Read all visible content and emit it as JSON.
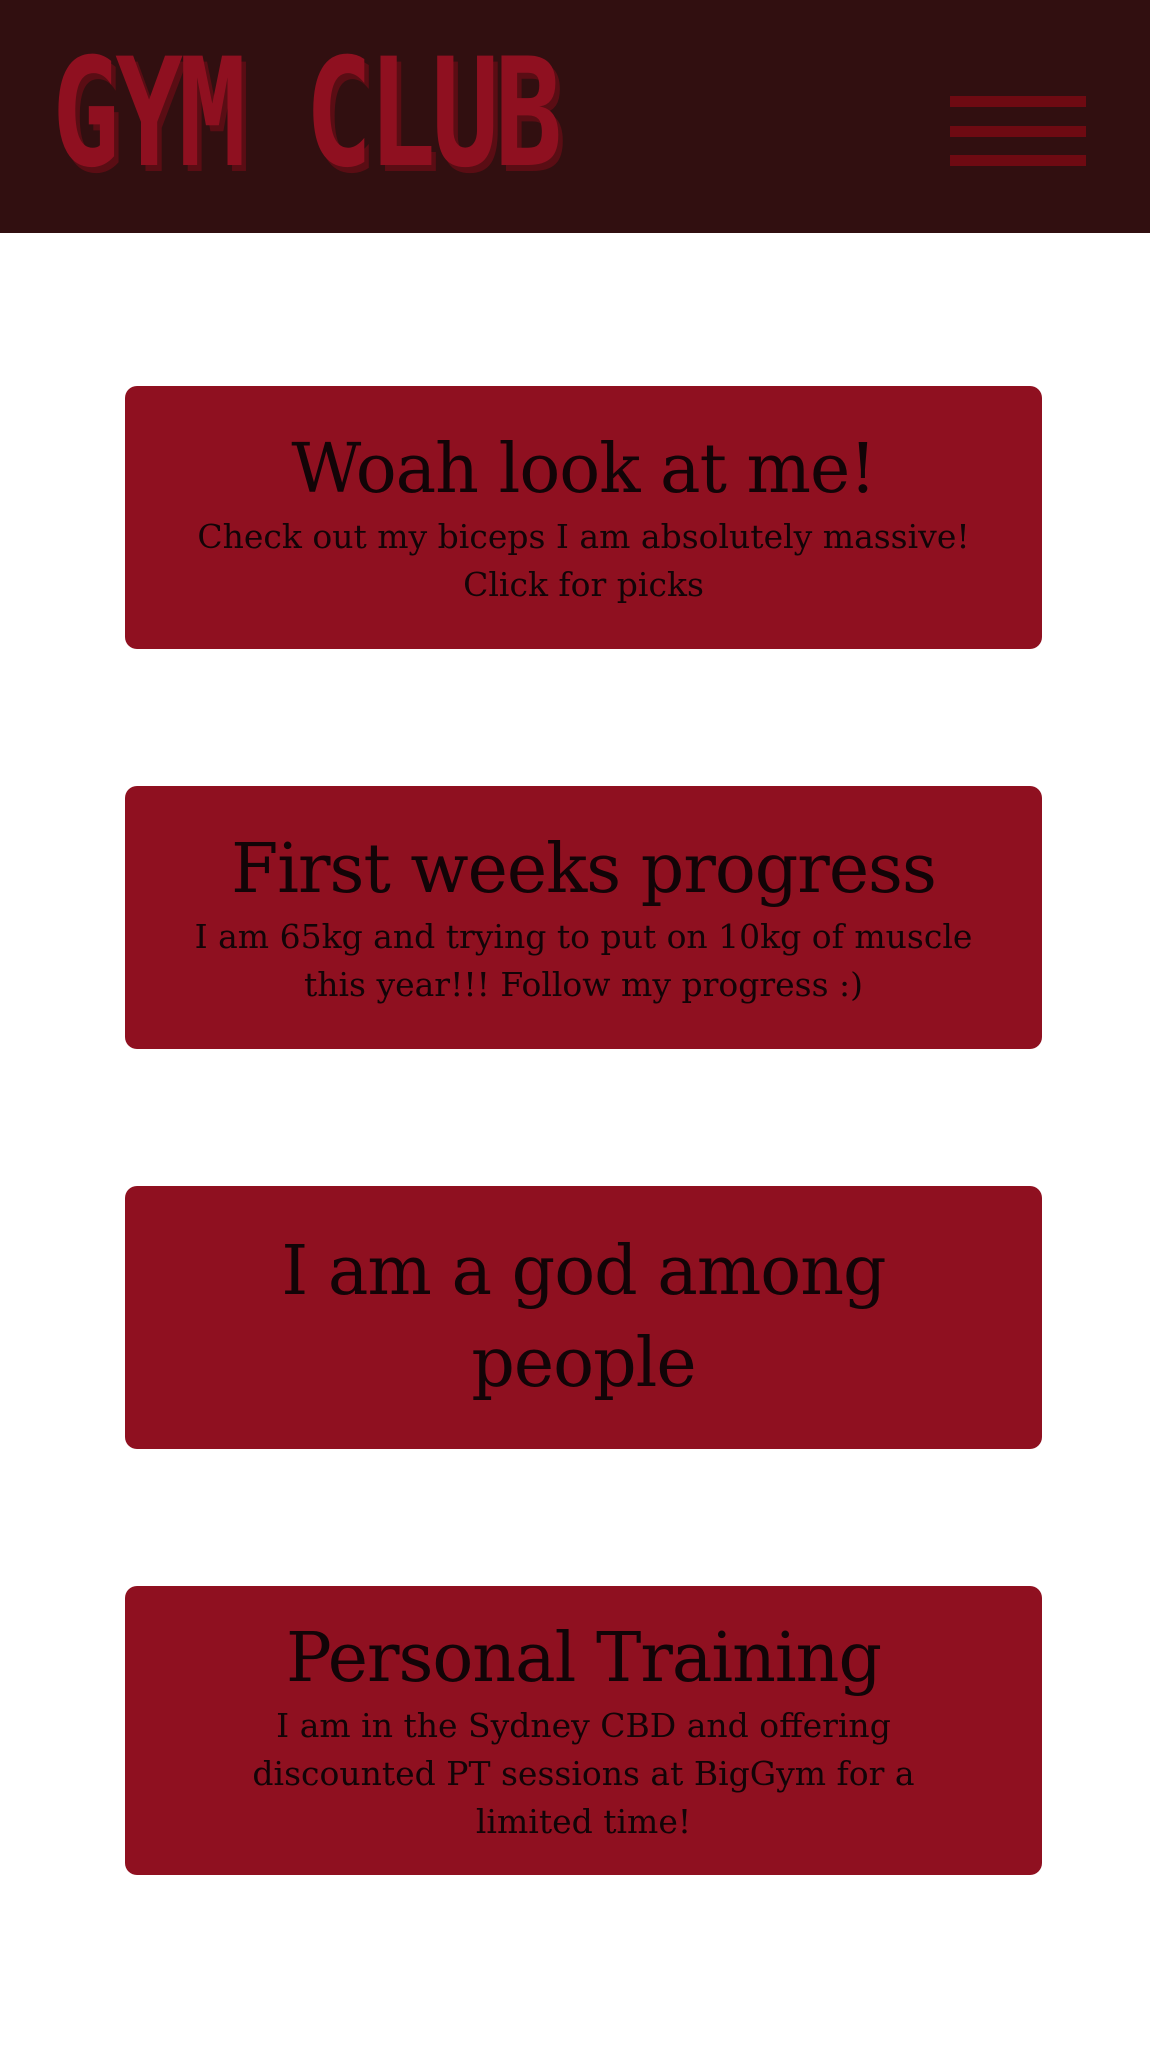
{
  "header": {
    "logo_text": "GYM CLUB",
    "menu_icon": "hamburger-menu-icon"
  },
  "colors": {
    "header_bg": "#310f10",
    "accent": "#8f1020",
    "text_dark": "#120407",
    "page_bg": "#ffffff"
  },
  "posts": [
    {
      "title": "Woah look at me!",
      "text": "Check out my biceps I am absolutely massive! Click for picks"
    },
    {
      "title": "First weeks progress",
      "text": "I am 65kg and trying to put on 10kg of muscle this year!!! Follow my progress :)"
    },
    {
      "title": "I am a god among people",
      "text": ""
    },
    {
      "title": "Personal Training",
      "text": "I am in the Sydney CBD and offering discounted PT sessions at BigGym for a limited time!"
    }
  ]
}
